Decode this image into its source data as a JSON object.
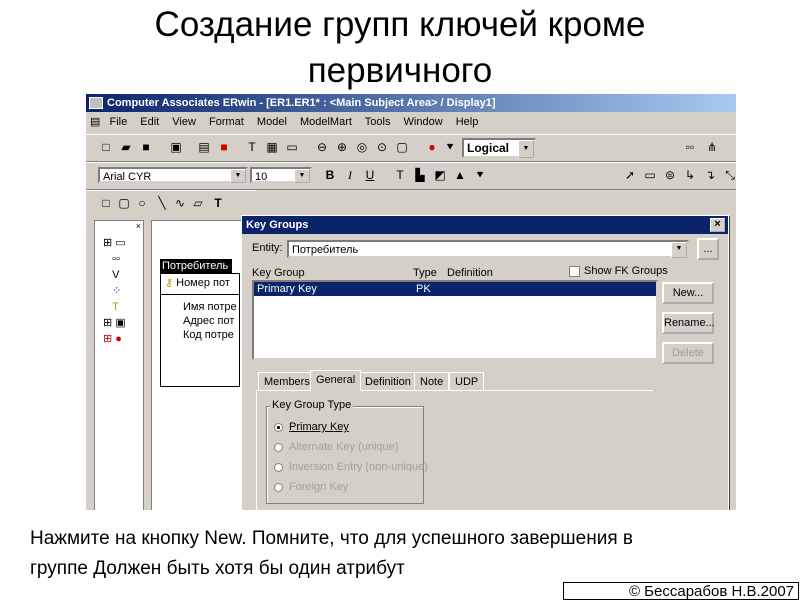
{
  "slide": {
    "title_line1": "Создание групп ключей кроме",
    "title_line2": "первичного",
    "caption_line1": "Нажмите на кнопку New. Помните, что для успешного завершения в",
    "caption_line2": "группе Должен быть хотя бы один атрибут",
    "copyright": "© Бессарабов Н.В.2007"
  },
  "window": {
    "title": "Computer Associates ERwin - [ER1.ER1* : <Main Subject Area> / Display1]",
    "menu": [
      "File",
      "Edit",
      "View",
      "Format",
      "Model",
      "ModelMart",
      "Tools",
      "Window",
      "Help"
    ],
    "view_combo": "Logical",
    "font_combo": "Arial CYR",
    "size_combo": "10",
    "text_buttons": [
      "B",
      "I",
      "U"
    ]
  },
  "entity": {
    "name": "Потребитель",
    "pk_attr": "Номер пот",
    "attrs": [
      "Имя потре",
      "Адрес пот",
      "Код потре"
    ]
  },
  "dialog": {
    "title": "Key Groups",
    "entity_label": "Entity:",
    "entity_value": "Потребитель",
    "more_button": "...",
    "col_key_group": "Key Group",
    "col_type": "Type",
    "col_definition": "Definition",
    "show_fk_label": "Show FK Groups",
    "rows": [
      {
        "name": "Primary Key",
        "type": "PK"
      }
    ],
    "buttons": {
      "new": "New...",
      "rename": "Rename...",
      "delete": "Delete"
    },
    "tabs": [
      "Members",
      "General",
      "Definition",
      "Note",
      "UDP"
    ],
    "active_tab": "General",
    "group_title": "Key Group Type",
    "options": [
      {
        "label": "Primary Key",
        "selected": true,
        "enabled": true
      },
      {
        "label": "Alternate Key (unique)",
        "selected": false,
        "enabled": false
      },
      {
        "label": "Inversion Entry (non-unique)",
        "selected": false,
        "enabled": false
      },
      {
        "label": "Foreign Key",
        "selected": false,
        "enabled": false
      }
    ]
  }
}
